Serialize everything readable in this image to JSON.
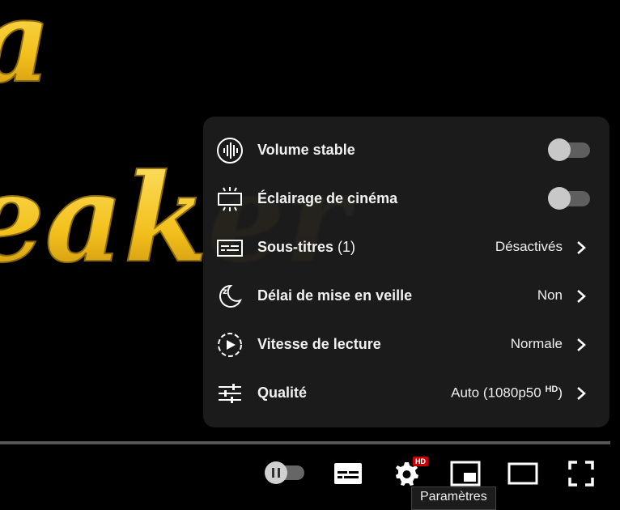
{
  "video": {
    "title_fragments": [
      "a",
      "eaker"
    ]
  },
  "settings": {
    "stable_volume": {
      "label": "Volume stable",
      "enabled": false,
      "icon": "stable-volume-icon"
    },
    "cinematic_lighting": {
      "label": "Éclairage de cinéma",
      "enabled": false,
      "icon": "ambient-mode-icon"
    },
    "subtitles": {
      "label": "Sous-titres",
      "count": "(1)",
      "value": "Désactivés",
      "icon": "subtitles-icon"
    },
    "sleep_timer": {
      "label": "Délai de mise en veille",
      "value": "Non",
      "icon": "sleep-timer-icon"
    },
    "playback_speed": {
      "label": "Vitesse de lecture",
      "value": "Normale",
      "icon": "playback-speed-icon"
    },
    "quality": {
      "label": "Qualité",
      "value_main": "Auto",
      "value_detail_open": "(1080p50",
      "value_hd": "HD",
      "value_detail_close": ")",
      "icon": "quality-sliders-icon"
    }
  },
  "controls": {
    "autoplay": {
      "icon": "autoplay-toggle-icon",
      "enabled": false
    },
    "subtitles_button": {
      "icon": "subtitles-icon"
    },
    "settings_button": {
      "icon": "gear-icon",
      "badge": "HD"
    },
    "miniplayer_button": {
      "icon": "miniplayer-icon"
    },
    "theater_button": {
      "icon": "theater-mode-icon"
    },
    "fullscreen_button": {
      "icon": "fullscreen-icon"
    }
  },
  "tooltip": {
    "text": "Paramètres"
  },
  "colors": {
    "panel_bg": "#1c1c1c",
    "hd_badge": "#cc0000",
    "title_yellow": "#f2c01c"
  }
}
